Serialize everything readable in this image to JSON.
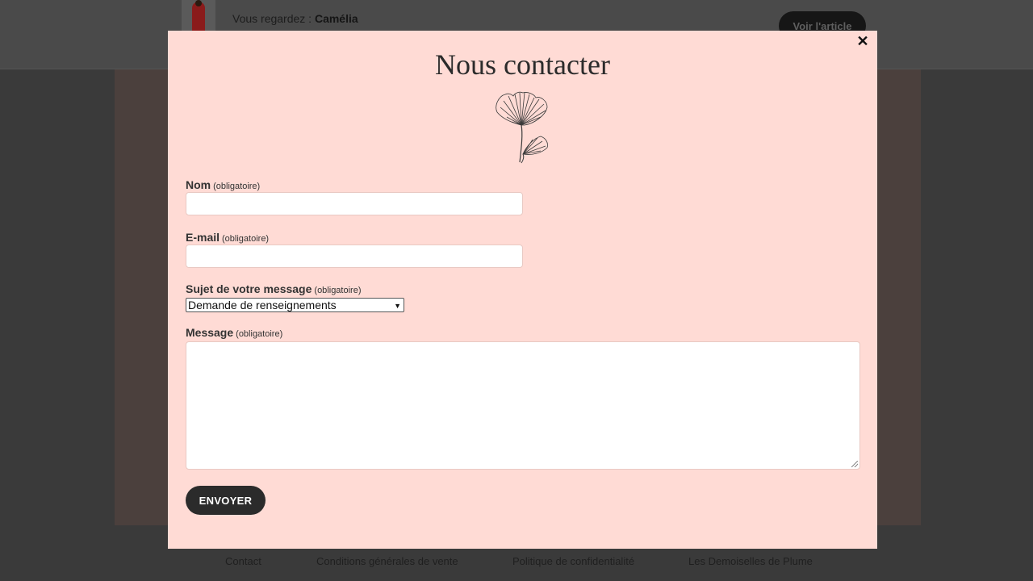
{
  "background": {
    "watching_prefix": "Vous regardez : ",
    "product_name": "Camélia",
    "view_button": "Voir l'article"
  },
  "footer": {
    "links": [
      "Contact",
      "Conditions générales de vente",
      "Politique de confidentialité",
      "Les Demoiselles de Plume"
    ]
  },
  "modal": {
    "close_symbol": "✕",
    "title": "Nous contacter",
    "decoration_icon": "ginkgo-leaf-icon",
    "fields": {
      "name": {
        "label": "Nom",
        "required": "(obligatoire)",
        "value": ""
      },
      "email": {
        "label": "E-mail",
        "required": "(obligatoire)",
        "value": ""
      },
      "subject": {
        "label": "Sujet de votre message",
        "required": "(obligatoire)",
        "selected": "Demande de renseignements"
      },
      "message": {
        "label": "Message",
        "required": "(obligatoire)",
        "value": ""
      }
    },
    "submit_label": "ENVOYER"
  },
  "colors": {
    "modal_bg": "#ffdbd5",
    "button_bg": "#2b2b2b",
    "overlay": "#3a3a3a"
  }
}
